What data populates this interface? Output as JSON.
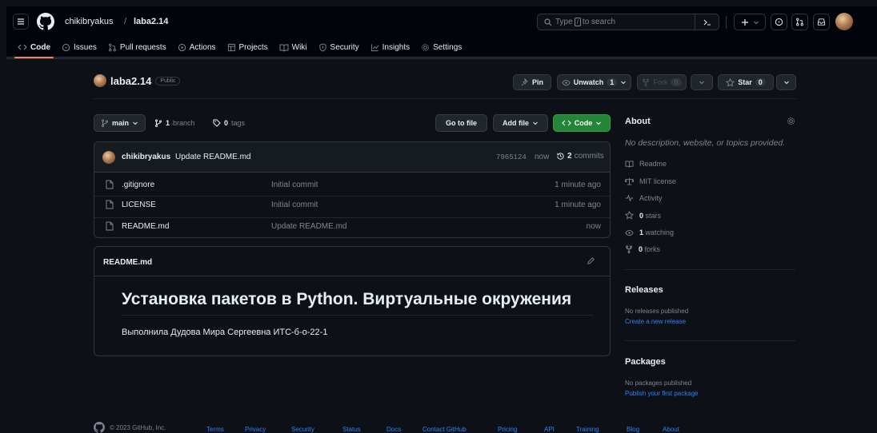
{
  "header": {
    "owner": "chikibryakus",
    "separator": "/",
    "repo": "laba2.14",
    "search": {
      "pre": "Type",
      "key": "/",
      "post": "to search"
    },
    "icons": [
      "menu-icon",
      "github-logo-icon",
      "terminal-icon",
      "plus-icon",
      "issue-icon",
      "pull-request-icon",
      "inbox-icon"
    ]
  },
  "nav": {
    "code": "Code",
    "issues": "Issues",
    "pulls": "Pull requests",
    "actions": "Actions",
    "projects": "Projects",
    "wiki": "Wiki",
    "security": "Security",
    "insights": "Insights",
    "settings": "Settings"
  },
  "repo": {
    "name": "laba2.14",
    "visibility": "Public",
    "pin": "Pin",
    "unwatch": "Unwatch",
    "watch_count": "1",
    "fork": "Fork",
    "fork_count": "0",
    "star": "Star",
    "star_count": "0"
  },
  "toolbar": {
    "branch": "main",
    "branch_count": "1",
    "branch_label": "branch",
    "tag_count": "0",
    "tag_label": "tags",
    "go_to_file": "Go to file",
    "add_file": "Add file",
    "code": "Code"
  },
  "commit": {
    "author": "chikibryakus",
    "message": "Update README.md",
    "hash": "7965124",
    "when": "now",
    "commits_count": "2",
    "commits_label": "commits"
  },
  "files": [
    {
      "name": ".gitignore",
      "message": "Initial commit",
      "age": "1 minute ago"
    },
    {
      "name": "LICENSE",
      "message": "Initial commit",
      "age": "1 minute ago"
    },
    {
      "name": "README.md",
      "message": "Update README.md",
      "age": "now"
    }
  ],
  "readme": {
    "file": "README.md",
    "heading": "Установка пакетов в Python. Виртуальные окружения",
    "text": "Выполнила Дудова Мира Сергеевна ИТС-б-о-22-1"
  },
  "about": {
    "title": "About",
    "description": "No description, website, or topics provided.",
    "readme": "Readme",
    "license": "MIT license",
    "activity": "Activity",
    "stars_count": "0",
    "stars_label": "stars",
    "watching_count": "1",
    "watching_label": "watching",
    "forks_count": "0",
    "forks_label": "forks"
  },
  "releases": {
    "title": "Releases",
    "none": "No releases published",
    "create": "Create a new release"
  },
  "packages": {
    "title": "Packages",
    "none": "No packages published",
    "publish": "Publish your first package"
  },
  "footer": {
    "copyright": "© 2023 GitHub, Inc.",
    "links": [
      "Terms",
      "Privacy",
      "Security",
      "Status",
      "Docs",
      "Contact GitHub",
      "Pricing",
      "API",
      "Training",
      "Blog",
      "About"
    ]
  },
  "colors": {
    "background": "#0d1117",
    "header": "#010409",
    "border": "#30363d",
    "accent_green": "#238636",
    "link_blue": "#2f81f7",
    "nav_underline": "#f78166"
  }
}
